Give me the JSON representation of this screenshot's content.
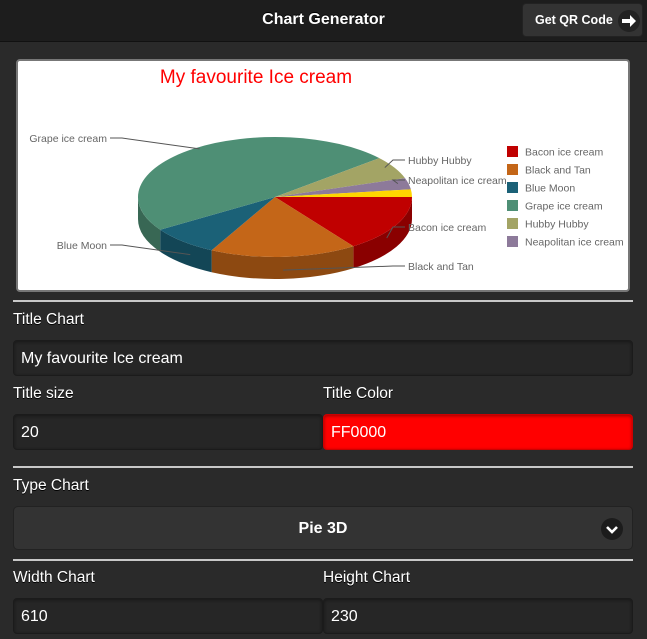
{
  "header": {
    "title": "Chart Generator",
    "qr_button_label": "Get QR Code"
  },
  "chart_data": {
    "type": "pie",
    "variant": "3d",
    "title": "My favourite Ice cream",
    "title_color": "#FF0000",
    "legend_position": "right",
    "slices": [
      {
        "label": "Bacon ice cream",
        "value": 15,
        "color": "#C00000"
      },
      {
        "label": "Black and Tan",
        "value": 17,
        "color": "#C46618"
      },
      {
        "label": "Blue Moon",
        "value": 8,
        "color": "#1B6177"
      },
      {
        "label": "Grape ice cream",
        "value": 47,
        "color": "#4E8F75"
      },
      {
        "label": "Hubby Hubby",
        "value": 6,
        "color": "#A3A465"
      },
      {
        "label": "Neapolitan ice cream",
        "value": 3,
        "color": "#8D7A9A"
      },
      {
        "label": "",
        "value": 2,
        "color": "#FFD500"
      }
    ],
    "legend": [
      "Bacon ice cream",
      "Black and Tan",
      "Blue Moon",
      "Grape ice cream",
      "Hubby Hubby",
      "Neapolitan ice cream"
    ]
  },
  "form": {
    "title_chart": {
      "label": "Title Chart",
      "value": "My favourite Ice cream"
    },
    "title_size": {
      "label": "Title size",
      "value": "20"
    },
    "title_color": {
      "label": "Title Color",
      "value": "FF0000"
    },
    "type_chart": {
      "label": "Type Chart",
      "value": "Pie 3D"
    },
    "width_chart": {
      "label": "Width Chart",
      "value": "610"
    },
    "height_chart": {
      "label": "Height Chart",
      "value": "230"
    }
  }
}
